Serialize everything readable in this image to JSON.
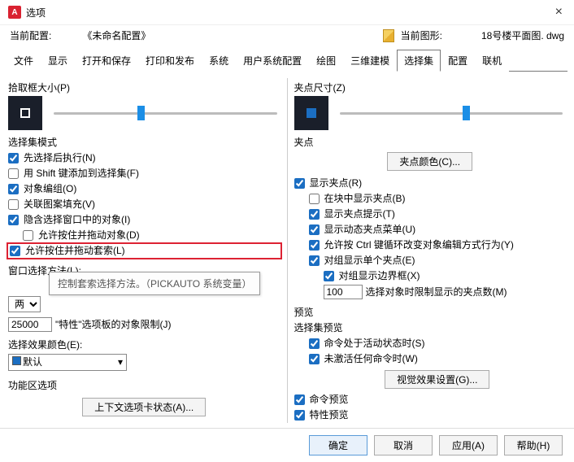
{
  "window": {
    "title": "选项",
    "close": "×"
  },
  "info": {
    "profile_label": "当前配置:",
    "profile_value": "《未命名配置》",
    "drawing_label": "当前图形:",
    "drawing_value": "18号楼平面图. dwg"
  },
  "tabs": [
    "文件",
    "显示",
    "打开和保存",
    "打印和发布",
    "系统",
    "用户系统配置",
    "绘图",
    "三维建模",
    "选择集",
    "配置",
    "联机"
  ],
  "active_tab": 8,
  "left": {
    "pickbox_label": "拾取框大小(P)",
    "sel_mode": "选择集模式",
    "c1": "先选择后执行(N)",
    "c2": "用 Shift 键添加到选择集(F)",
    "c3": "对象编组(O)",
    "c4": "关联图案填充(V)",
    "c5": "隐含选择窗口中的对象(I)",
    "c5a": "允许按住并拖动对象(D)",
    "c5b": "允许按住并拖动套索(L)",
    "win_method": "窗口选择方法(L):",
    "tooltip": "控制套索选择方法。（PICKAUTO 系统变量）",
    "both_opt": "两者",
    "limit_val": "25000",
    "limit_label": "\"特性\"选项板的对象限制(J)",
    "color_label": "选择效果颜色(E):",
    "color_val": "默认",
    "ribbon": "功能区选项",
    "ribbon_btn": "上下文选项卡状态(A)..."
  },
  "right": {
    "grip_size": "夹点尺寸(Z)",
    "grips": "夹点",
    "grip_color_btn": "夹点颜色(C)...",
    "g1": "显示夹点(R)",
    "g2": "在块中显示夹点(B)",
    "g3": "显示夹点提示(T)",
    "g4": "显示动态夹点菜单(U)",
    "g5": "允许按 Ctrl 键循环改变对象编辑方式行为(Y)",
    "g6": "对组显示单个夹点(E)",
    "g7": "对组显示边界框(X)",
    "limit_val": "100",
    "limit_label": "选择对象时限制显示的夹点数(M)",
    "preview": "预览",
    "sel_preview": "选择集预览",
    "p1": "命令处于活动状态时(S)",
    "p2": "未激活任何命令时(W)",
    "vis_btn": "视觉效果设置(G)...",
    "p3": "命令预览",
    "p4": "特性预览"
  },
  "footer": {
    "ok": "确定",
    "cancel": "取消",
    "apply": "应用(A)",
    "help": "帮助(H)"
  }
}
